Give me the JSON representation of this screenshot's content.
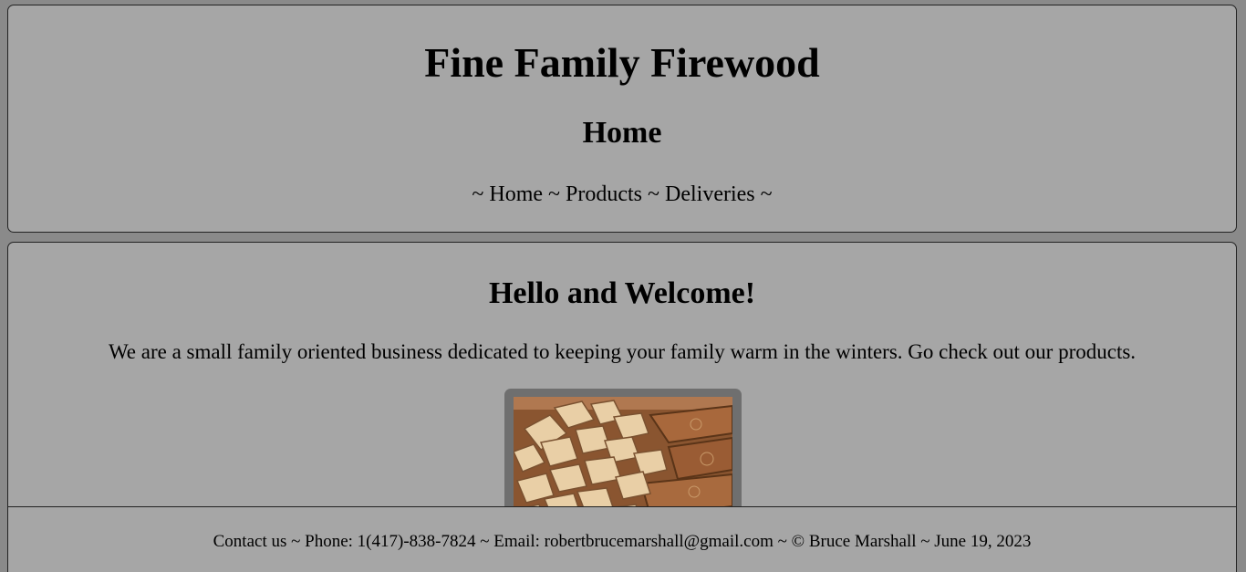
{
  "header": {
    "site_title": "Fine Family Firewood",
    "page_heading": "Home",
    "nav": {
      "sep": "~",
      "items": [
        {
          "label": "Home"
        },
        {
          "label": "Products"
        },
        {
          "label": "Deliveries"
        }
      ]
    }
  },
  "main": {
    "welcome_heading": "Hello and Welcome!",
    "intro_text": "We are a small family oriented business dedicated to keeping your family warm in the winters. Go check out our products.",
    "image_icon": "firewood-stack-photo"
  },
  "footer": {
    "text": "Contact us ~ Phone: 1(417)-838-7824 ~ Email: robertbrucemarshall@gmail.com ~ © Bruce Marshall ~ June 19, 2023"
  },
  "colors": {
    "page_background": "#8a8a8a",
    "panel_background": "#a6a6a6",
    "photo_frame": "#6f6f6f"
  }
}
